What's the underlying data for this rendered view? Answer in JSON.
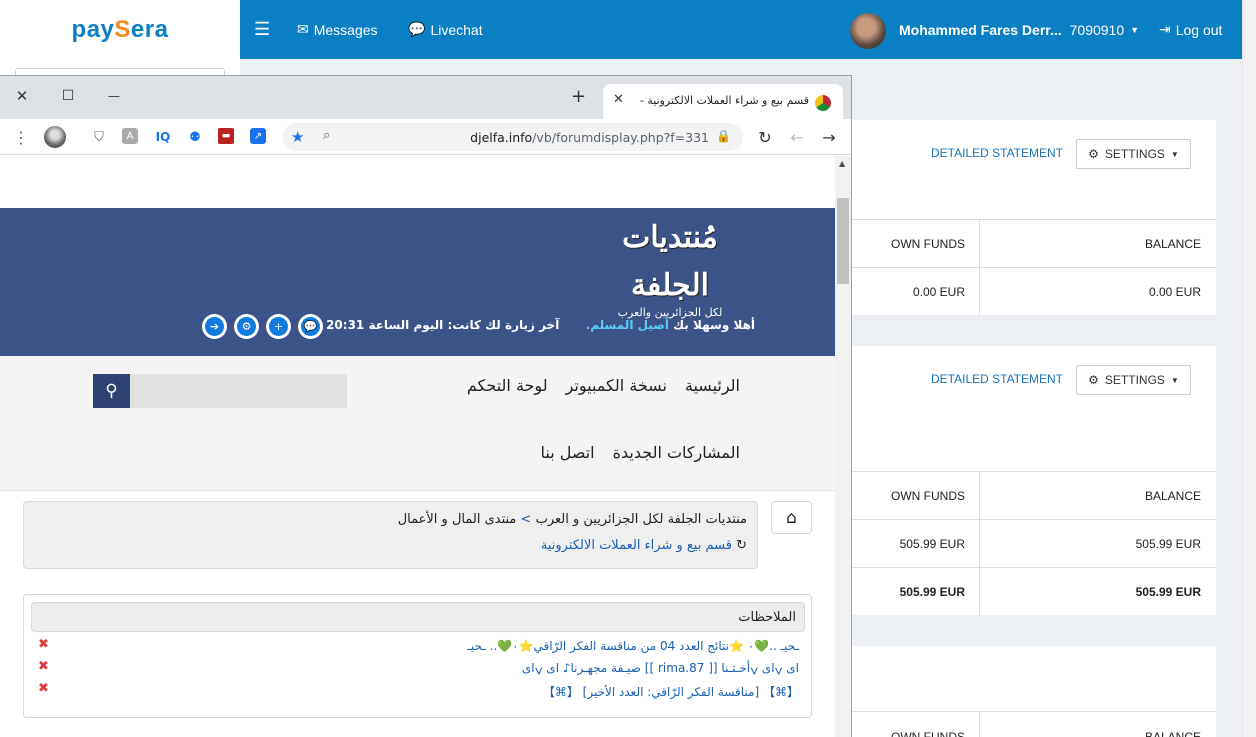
{
  "paysera": {
    "logo": {
      "part1": "pay",
      "accent": "S",
      "part2": "era"
    },
    "nav": {
      "menu_icon": "hamburger-icon",
      "messages": "Messages",
      "livechat": "Livechat",
      "user_name": "Mohammed Fares Derr...",
      "user_code": "7090910",
      "logout": "Log out"
    },
    "cards": [
      {
        "detailed_statement": "DETAILED STATEMENT",
        "settings": "SETTINGS",
        "col_own_funds": "OWN FUNDS",
        "col_balance": "BALANCE",
        "rows": [
          {
            "own_funds": "0.00 EUR",
            "balance": "0.00 EUR"
          }
        ]
      },
      {
        "detailed_statement": "DETAILED STATEMENT",
        "settings": "SETTINGS",
        "col_own_funds": "OWN FUNDS",
        "col_balance": "BALANCE",
        "rows": [
          {
            "own_funds": "505.99 EUR",
            "balance": "505.99 EUR"
          },
          {
            "own_funds": "505.99 EUR",
            "balance": "505.99 EUR"
          }
        ]
      },
      {
        "col_own_funds": "OWN FUNDS",
        "col_balance": "BALANCE"
      }
    ]
  },
  "browser": {
    "tab_title": "قسم بيع و شراء العملات الالكترونية -",
    "url_host": "djelfa.info",
    "url_path": "/vb/forumdisplay.php?f=331",
    "window_controls": {
      "close": "✕",
      "maximize": "☐",
      "minimize": "—"
    }
  },
  "forum": {
    "logo_main": "مُنتديات الجلفة",
    "logo_sub": "لكل الجزائريين والعرب",
    "welcome_prefix": "أهلا وسهلا بك",
    "welcome_user": "أصيل المسلم.",
    "last_visit": "آخر زيارة لك كانت: اليوم الساعة 20:31",
    "nav_row1": [
      "الرئيسية",
      "نسخة الكمبيوتر",
      "لوحة التحكم"
    ],
    "nav_row2": [
      "المشاركات الجديدة",
      "اتصل بنا"
    ],
    "breadcrumb_root": "منتديات الجلفة لكل الجزائريين و العرب",
    "breadcrumb_sep": ">",
    "breadcrumb_parent": "منتدى المال و الأعمال",
    "breadcrumb_current": "قسم بيع و شراء العملات الالكترونية",
    "notes_title": "الملاحظات",
    "notes": [
      "ـحيـ ..💚۰ ⭐نتائج العدد 04 من مناقسة الفكر الرّاقي⭐۰💚.. ـحيـ",
      "ای ݍای ݍأخـتـنا [[ rima.87 ]] ضيـفة مجهـرنا♪ ای ݍای",
      "【⌘】 [مناقسة الفكر الرّاقي: العدد الأخير] 【⌘】"
    ]
  }
}
